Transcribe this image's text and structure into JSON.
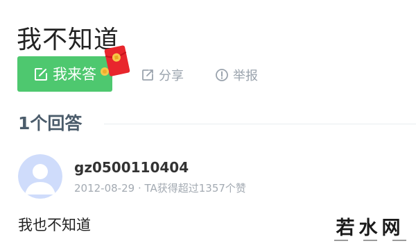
{
  "question": {
    "title": "我不知道"
  },
  "actions": {
    "answer_label": "我来答",
    "share_label": "分享",
    "report_label": "举报"
  },
  "answers_section": {
    "heading": "1个回答"
  },
  "answer": {
    "author": "gz0500110404",
    "meta": "2012-08-29 · TA获得超过1357个赞",
    "content": "我也不知道"
  },
  "watermark": {
    "text": "若水网"
  },
  "icons": {
    "edit": "edit-icon",
    "redpacket": "red-envelope-icon",
    "share": "share-icon",
    "report": "report-icon",
    "avatar": "default-avatar-icon"
  },
  "colors": {
    "accent_green": "#4ec86f",
    "muted_text": "#9aa3ad",
    "heading_text": "#4b5c6b",
    "red_envelope": "#e8262d"
  }
}
